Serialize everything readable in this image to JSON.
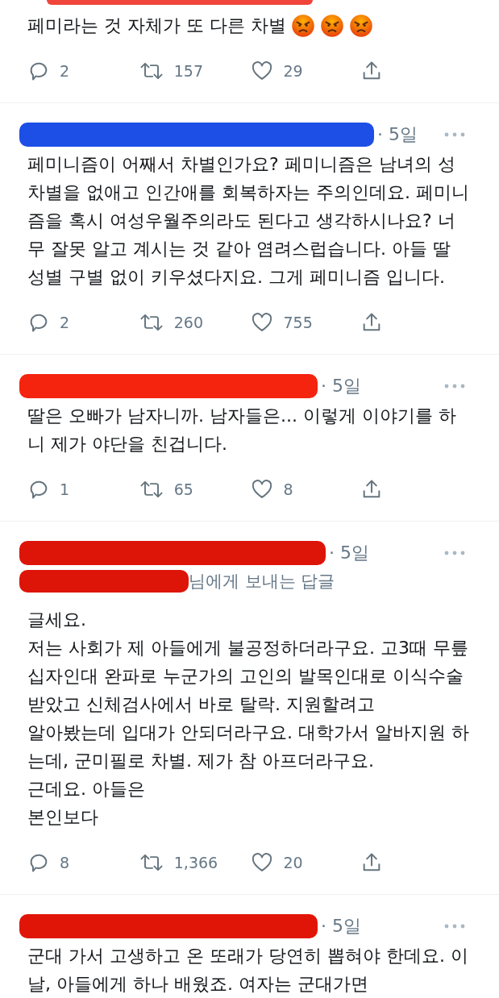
{
  "tweets": [
    {
      "kind": "cut",
      "color": "#f0453a",
      "paragraphs": [
        "페미라는 것 자체가 또 다른 차별"
      ],
      "emojis": [
        {
          "kind": "angry"
        },
        {
          "kind": "angry"
        },
        {
          "kind": "angry"
        }
      ],
      "actions": {
        "replies": "2",
        "retweets": "157",
        "likes": "29"
      }
    },
    {
      "kind": "full",
      "color": "#1d4fe6",
      "time": "· 5일",
      "paragraphs": [
        "페미니즘이 어째서 차별인가요? 페미니즘은 남녀의 성차별을 없애고 인간애를 회복하자는 주의인데요. 페미니즘을 혹시 여성우월주의라도 된다고 생각하시나요? 너무 잘못 알고 계시는 것 같아 염려스럽습니다. 아들 딸 성별 구별 없이 키우셨다지요. 그게 페미니즘 입니다."
      ],
      "actions": {
        "replies": "2",
        "retweets": "260",
        "likes": "755"
      }
    },
    {
      "kind": "full",
      "color": "#f4240f",
      "time": "· 5일",
      "paragraphs": [
        "딸은 오빠가 남자니까. 남자들은... 이렇게 이야기를 하니 제가 야단을 친겁니다."
      ],
      "actions": {
        "replies": "1",
        "retweets": "65",
        "likes": "8"
      }
    },
    {
      "kind": "reply",
      "color": "#dd1408",
      "time": "· 5일",
      "reply_to": "님에게 보내는 답글",
      "paragraphs": [
        "글세요.",
        "저는 사회가 제 아들에게 불공정하더라구요. 고3때 무릎십자인대 완파로 누군가의 고인의 발목인대로 이식수술 받았고 신체검사에서 바로 탈락. 지원할려고",
        "알아봤는데 입대가 안되더라구요. 대학가서 알바지원 하는데, 군미필로  차별. 제가 참 아프더라구요.",
        "근데요. 아들은",
        "본인보다"
      ],
      "actions": {
        "replies": "8",
        "retweets": "1,366",
        "likes": "20"
      }
    },
    {
      "kind": "full",
      "color": "#e11507",
      "time": "· 5일",
      "paragraphs": [
        "군대 가서 고생하고 온 또래가 당연히 뽑혀야 한데요. 이날, 아들에게 하나 배웠죠. 여자는 군대가면"
      ]
    }
  ]
}
